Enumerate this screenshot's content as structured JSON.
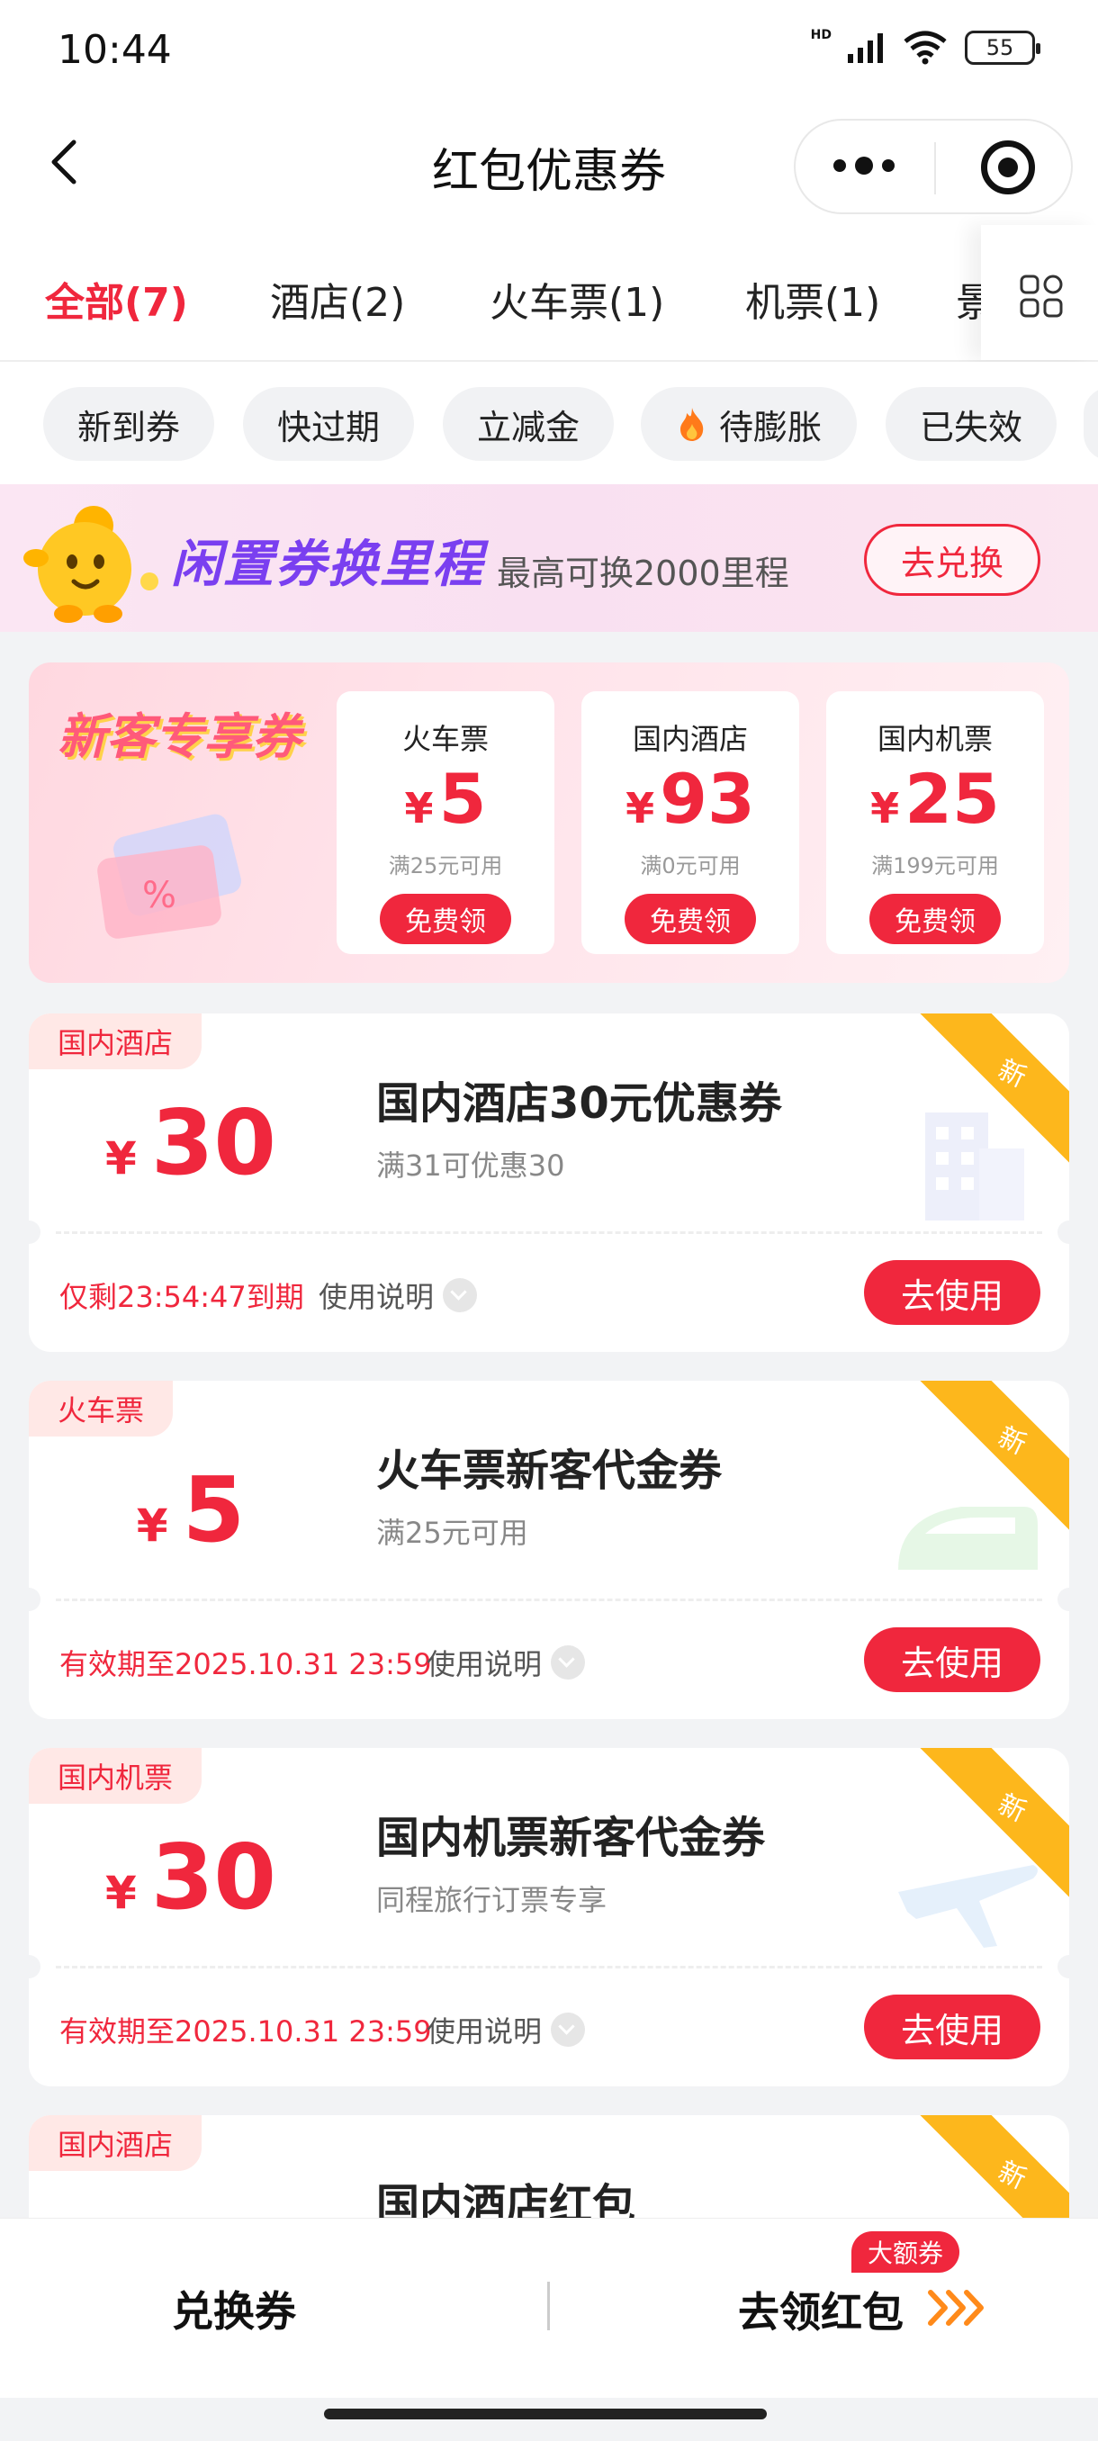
{
  "status_bar": {
    "time": "10:44",
    "network": "HD",
    "battery": "55"
  },
  "header": {
    "title": "红包优惠券"
  },
  "tabs": [
    {
      "label": "全部(7)",
      "active": true
    },
    {
      "label": "酒店(2)"
    },
    {
      "label": "火车票(1)"
    },
    {
      "label": "机票(1)"
    },
    {
      "label": "景"
    }
  ],
  "filters": [
    "新到券",
    "快过期",
    "立减金",
    "待膨胀",
    "已失效"
  ],
  "banner": {
    "title": "闲置券换里程",
    "subtitle": "最高可换2000里程",
    "button": "去兑换"
  },
  "new_customer": {
    "title": "新客专享券",
    "currency": "¥",
    "items": [
      {
        "category": "火车票",
        "amount": "5",
        "condition": "满25元可用",
        "button": "免费领"
      },
      {
        "category": "国内酒店",
        "amount": "93",
        "condition": "满0元可用",
        "button": "免费领"
      },
      {
        "category": "国内机票",
        "amount": "25",
        "condition": "满199元可用",
        "button": "免费领"
      }
    ]
  },
  "coupons": [
    {
      "tag": "国内酒店",
      "currency": "¥",
      "amount": "30",
      "name": "国内酒店30元优惠券",
      "desc": "满31可优惠30",
      "expiry": "仅剩23:54:47到期",
      "help": "使用说明",
      "button": "去使用",
      "ribbon": "新"
    },
    {
      "tag": "火车票",
      "currency": "¥",
      "amount": "5",
      "name": "火车票新客代金券",
      "desc": "满25元可用",
      "expiry": "有效期至2025.10.31 23:59",
      "help": "使用说明",
      "button": "去使用",
      "ribbon": "新"
    },
    {
      "tag": "国内机票",
      "currency": "¥",
      "amount": "30",
      "name": "国内机票新客代金券",
      "desc": "同程旅行订票专享",
      "expiry": "有效期至2025.10.31 23:59",
      "help": "使用说明",
      "button": "去使用",
      "ribbon": "新"
    },
    {
      "tag": "国内酒店",
      "name": "国内酒店红包",
      "ribbon": "新"
    }
  ],
  "bottom_bar": {
    "left": "兑换券",
    "right": "去领红包",
    "badge": "大额券"
  },
  "colors": {
    "accent": "#f0273d",
    "ribbon": "#fdb71c",
    "banner_text": "#7a3ff0"
  }
}
